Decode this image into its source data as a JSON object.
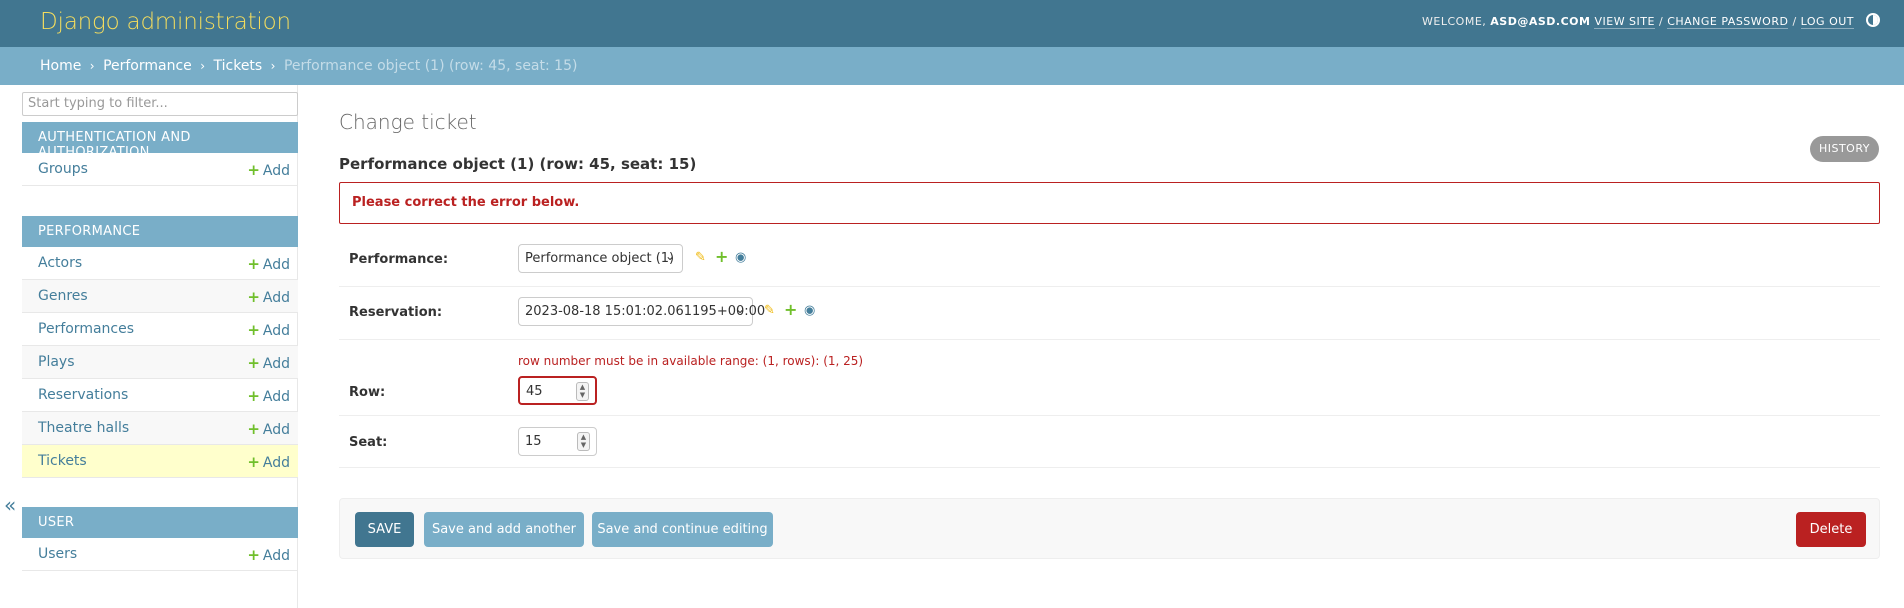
{
  "header": {
    "site_name": "Django administration",
    "welcome": "WELCOME,",
    "user": "ASD@ASD.COM",
    "view_site": "VIEW SITE",
    "separator": "/",
    "change_password": "CHANGE PASSWORD",
    "log_out": "LOG OUT"
  },
  "breadcrumbs": {
    "home": "Home",
    "app": "Performance",
    "model": "Tickets",
    "current": "Performance object (1) (row: 45, seat: 15)",
    "sep": "›"
  },
  "sidebar": {
    "filter_placeholder": "Start typing to filter...",
    "add_label": "Add",
    "collapse": "«",
    "modules": [
      {
        "caption": "Authentication and Authorization",
        "items": [
          "Groups"
        ]
      },
      {
        "caption": "Performance",
        "items": [
          "Actors",
          "Genres",
          "Performances",
          "Plays",
          "Reservations",
          "Theatre halls",
          "Tickets"
        ]
      },
      {
        "caption": "User",
        "items": [
          "Users"
        ]
      }
    ],
    "active_item": "Tickets"
  },
  "content": {
    "title": "Change ticket",
    "history": "History",
    "object_title": "Performance object (1) (row: 45, seat: 15)",
    "error_note": "Please correct the error below.",
    "fields": {
      "performance": {
        "label": "Performance:",
        "value": "Performance object (1)"
      },
      "reservation": {
        "label": "Reservation:",
        "value": "2023-08-18 15:01:02.061195+00:00"
      },
      "row": {
        "label": "Row:",
        "value": "45",
        "error": "row number must be in available range: (1, rows): (1, 25)"
      },
      "seat": {
        "label": "Seat:",
        "value": "15"
      }
    }
  },
  "submit": {
    "save": "SAVE",
    "save_add": "Save and add another",
    "save_continue": "Save and continue editing",
    "delete": "Delete"
  },
  "colors": {
    "header_bg": "#417690",
    "breadcrumb_bg": "#79aec8",
    "site_name": "#f5dd5d",
    "error": "#ba2121",
    "add_green": "#70bf2b",
    "link": "#447e9b",
    "active_row": "#ffffcc"
  },
  "icons": {
    "edit": "pencil-icon",
    "add": "plus-icon",
    "view": "eye-icon",
    "theme": "theme-toggle-icon"
  }
}
